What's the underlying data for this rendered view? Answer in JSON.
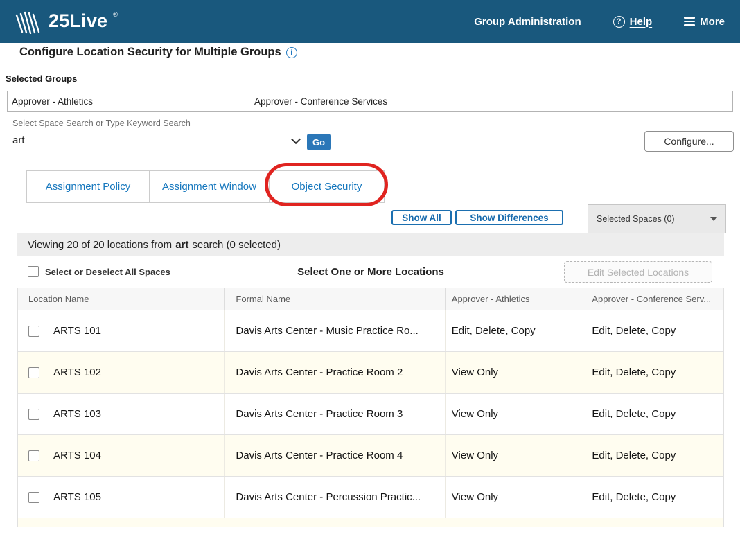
{
  "navbar": {
    "brand": "25Live",
    "brand_mark": "®",
    "group_admin": "Group Administration",
    "help": "Help",
    "more": "More"
  },
  "icons": {
    "help_glyph": "?",
    "info_glyph": "i"
  },
  "page": {
    "title": "Configure Location Security for Multiple Groups",
    "selected_groups_label": "Selected Groups",
    "selected_groups": [
      "Approver - Athletics",
      "Approver - Conference Services"
    ],
    "search_label": "Select Space Search or Type Keyword Search",
    "search_value": "art",
    "go_button": "Go",
    "configure_button": "Configure..."
  },
  "tabs": [
    {
      "label": "Assignment Policy",
      "annotated": false
    },
    {
      "label": "Assignment Window",
      "annotated": false
    },
    {
      "label": "Object Security",
      "annotated": true
    }
  ],
  "controls": {
    "show_all": "Show All",
    "show_differences": "Show Differences",
    "selected_spaces": "Selected Spaces (0)"
  },
  "status": {
    "prefix": "Viewing 20 of 20 locations from",
    "term": "art",
    "suffix": "search (0 selected)"
  },
  "toolbar": {
    "select_all_label": "Select or Deselect All Spaces",
    "heading": "Select One or More Locations",
    "edit_selected": "Edit Selected Locations"
  },
  "table": {
    "columns": [
      "Location Name",
      "Formal Name",
      "Approver - Athletics",
      "Approver - Conference Serv..."
    ],
    "rows": [
      {
        "location": "ARTS 101",
        "formal": "Davis Arts Center - Music Practice Ro...",
        "athletics": "Edit, Delete, Copy",
        "conference": "Edit, Delete, Copy"
      },
      {
        "location": "ARTS 102",
        "formal": "Davis Arts Center - Practice Room 2",
        "athletics": "View Only",
        "conference": "Edit, Delete, Copy"
      },
      {
        "location": "ARTS 103",
        "formal": "Davis Arts Center - Practice Room 3",
        "athletics": "View Only",
        "conference": "Edit, Delete, Copy"
      },
      {
        "location": "ARTS 104",
        "formal": "Davis Arts Center - Practice Room 4",
        "athletics": "View Only",
        "conference": "Edit, Delete, Copy"
      },
      {
        "location": "ARTS 105",
        "formal": "Davis Arts Center - Percussion Practic...",
        "athletics": "View Only",
        "conference": "Edit, Delete, Copy"
      }
    ]
  },
  "colors": {
    "navbar_bg": "#19587d",
    "link_blue": "#1778be",
    "button_blue": "#2b77b8",
    "annotation_red": "#e02420",
    "row_alt": "#fffdf0"
  }
}
